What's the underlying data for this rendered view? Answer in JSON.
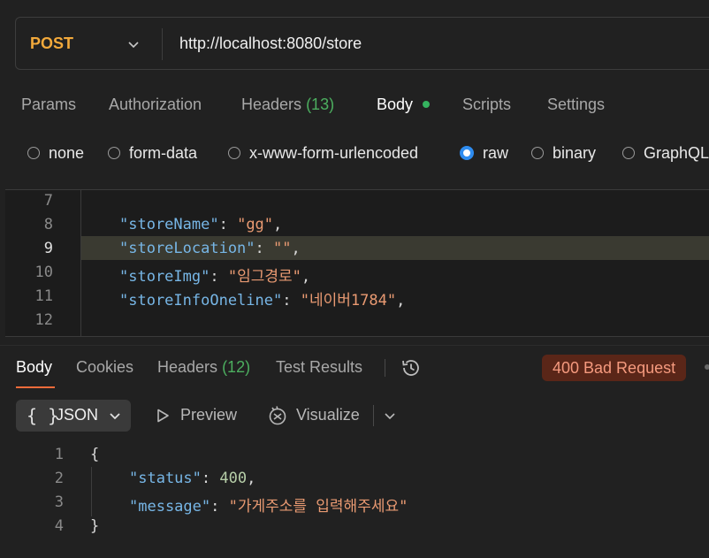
{
  "request": {
    "method": "POST",
    "url": "http://localhost:8080/store"
  },
  "request_tabs": [
    {
      "label": "Params"
    },
    {
      "label": "Authorization"
    },
    {
      "label": "Headers",
      "count": "(13)"
    },
    {
      "label": "Body",
      "active": true
    },
    {
      "label": "Scripts"
    },
    {
      "label": "Settings"
    }
  ],
  "body_modes": [
    {
      "label": "none",
      "checked": false
    },
    {
      "label": "form-data",
      "checked": false
    },
    {
      "label": "x-www-form-urlencoded",
      "checked": false
    },
    {
      "label": "raw",
      "checked": true
    },
    {
      "label": "binary",
      "checked": false
    },
    {
      "label": "GraphQL",
      "checked": false
    }
  ],
  "request_body": {
    "lines": [
      {
        "num": "7",
        "key": "",
        "value": ""
      },
      {
        "num": "8",
        "key": "\"storeName\"",
        "value": "\"gg\""
      },
      {
        "num": "9",
        "key": "\"storeLocation\"",
        "value": "\"\""
      },
      {
        "num": "10",
        "key": "\"storeImg\"",
        "value": "\"임그경로\""
      },
      {
        "num": "11",
        "key": "\"storeInfoOneline\"",
        "value": "\"네이버1784\""
      },
      {
        "num": "12",
        "key": "",
        "value": ""
      }
    ]
  },
  "response_tabs": [
    {
      "label": "Body",
      "active": true
    },
    {
      "label": "Cookies"
    },
    {
      "label": "Headers",
      "count": "(12)"
    },
    {
      "label": "Test Results"
    }
  ],
  "status": {
    "text": "400 Bad Request",
    "color": "#f59a7e"
  },
  "response_toolbar": {
    "format_brace": "{ }",
    "format": "JSON",
    "preview": "Preview",
    "visualize": "Visualize"
  },
  "response_body": {
    "line_numbers": [
      "1",
      "2",
      "3",
      "4"
    ],
    "open": "{",
    "close": "}",
    "status_key": "\"status\"",
    "status_value": "400",
    "message_key": "\"message\"",
    "message_value": "\"가게주소를 입력해주세요\""
  },
  "colors": {
    "method": "#f2a93b",
    "accent": "#f26b3a",
    "json_key": "#77b6e6",
    "json_string": "#e99a72",
    "json_number": "#b6cea8",
    "radio_selected": "#2e8cf0",
    "count_green": "#4cae5f"
  }
}
